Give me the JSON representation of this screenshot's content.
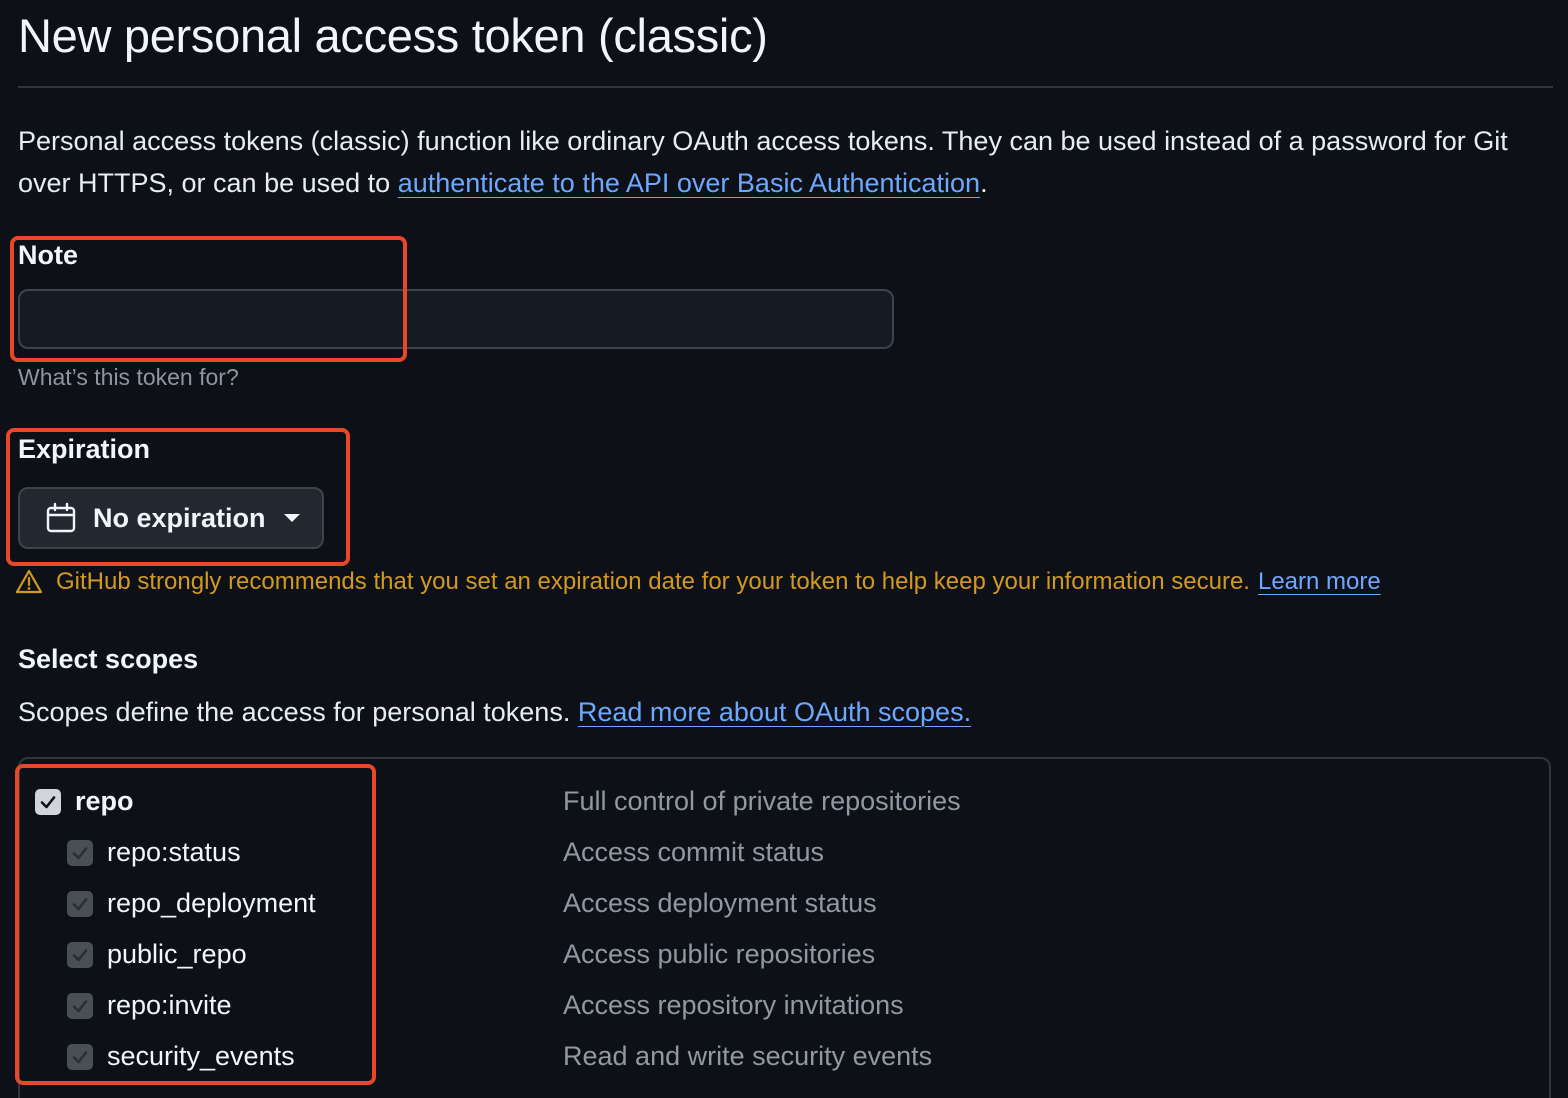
{
  "header": {
    "title": "New personal access token (classic)"
  },
  "intro": {
    "text_before": "Personal access tokens (classic) function like ordinary OAuth access tokens. They can be used instead of a password for Git over HTTPS, or can be used to ",
    "link": "authenticate to the API over Basic Authentication",
    "text_after": "."
  },
  "note": {
    "label": "Note",
    "value": "",
    "placeholder": "",
    "hint": "What’s this token for?"
  },
  "expiration": {
    "label": "Expiration",
    "selected": "No expiration",
    "warning": "GitHub strongly recommends that you set an expiration date for your token to help keep your information secure.",
    "warning_link": "Learn more"
  },
  "scopes": {
    "title": "Select scopes",
    "description": "Scopes define the access for personal tokens.",
    "description_link": "Read more about OAuth scopes.",
    "items": [
      {
        "name": "repo",
        "description": "Full control of private repositories",
        "checked": true,
        "parent": true
      },
      {
        "name": "repo:status",
        "description": "Access commit status",
        "checked": true,
        "parent": false
      },
      {
        "name": "repo_deployment",
        "description": "Access deployment status",
        "checked": true,
        "parent": false
      },
      {
        "name": "public_repo",
        "description": "Access public repositories",
        "checked": true,
        "parent": false
      },
      {
        "name": "repo:invite",
        "description": "Access repository invitations",
        "checked": true,
        "parent": false
      },
      {
        "name": "security_events",
        "description": "Read and write security events",
        "checked": true,
        "parent": false
      }
    ]
  },
  "colors": {
    "background": "#0d1117",
    "link": "#6ea8fe",
    "warning": "#d29922",
    "annotation": "#e8472a"
  }
}
